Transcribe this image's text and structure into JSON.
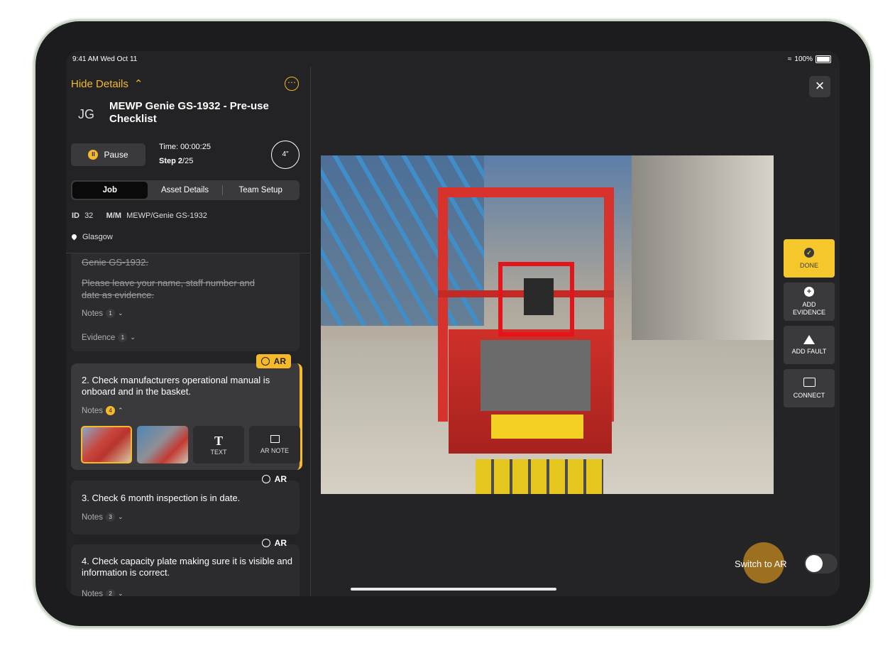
{
  "status_bar": {
    "time": "9:41 AM  Wed Oct 11",
    "battery": "100%"
  },
  "panel": {
    "hide_details": "Hide Details",
    "initials": "JG",
    "job_title": "MEWP Genie GS-1932 - Pre-use Checklist",
    "pause_label": "Pause",
    "time_label": "Time: 00:00:25",
    "step_prefix": "Step 2",
    "step_suffix": "/25",
    "timer_value": "4\"",
    "tabs": [
      {
        "label": "Job"
      },
      {
        "label": "Asset Details"
      },
      {
        "label": "Team Setup"
      }
    ],
    "id_label": "ID",
    "id_value": "32",
    "mm_label": "M/M",
    "mm_value": "MEWP/Genie GS-1932",
    "location": "Glasgow"
  },
  "steps": [
    {
      "text_line1": "Genie GS-1932.",
      "text_line2": "Please leave your name, staff number and",
      "text_line3": "date as evidence.",
      "notes_label": "Notes",
      "notes_count": "1",
      "evidence_label": "Evidence",
      "evidence_count": "1"
    },
    {
      "ar_label": "AR",
      "text": "2. Check manufacturers operational manual is onboard and in the basket.",
      "notes_label": "Notes",
      "notes_count": "4",
      "attach_text": "TEXT",
      "attach_text_glyph": "T",
      "attach_ar_note": "AR NOTE"
    },
    {
      "ar_label": "AR",
      "text": "3. Check 6 month inspection is in date.",
      "notes_label": "Notes",
      "notes_count": "3"
    },
    {
      "ar_label": "AR",
      "text": "4. Check capacity plate making sure it is visible and information is correct.",
      "notes_label": "Notes",
      "notes_count": "2"
    }
  ],
  "side_actions": [
    {
      "label": "DONE",
      "icon": "checkmark-icon"
    },
    {
      "label_line1": "ADD",
      "label_line2": "EVIDENCE",
      "icon": "plus-icon"
    },
    {
      "label": "ADD FAULT",
      "icon": "warning-icon"
    },
    {
      "label": "CONNECT",
      "icon": "chat-icon"
    }
  ],
  "switch_ar": {
    "label": "Switch to AR",
    "on": false
  },
  "colors": {
    "accent": "#f6b928",
    "target": "#e3141a",
    "panel": "#232325"
  }
}
